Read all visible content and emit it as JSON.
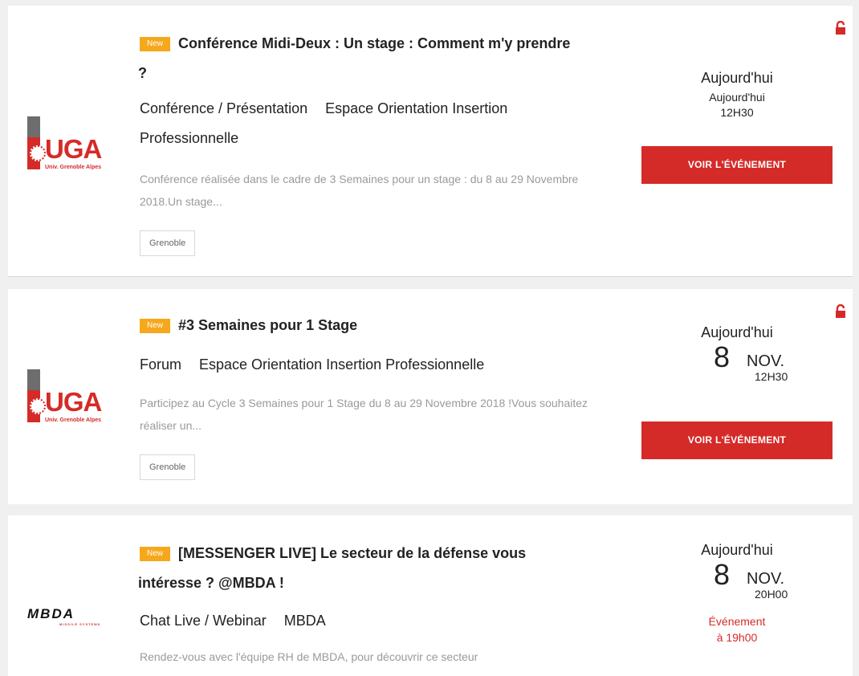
{
  "colors": {
    "accent": "#d52b28",
    "badge": "#f6a81c",
    "background": "#f0f0f0"
  },
  "events": [
    {
      "logo": {
        "text": "UGA",
        "sub": "Univ. Grenoble Alpes"
      },
      "badge": "New",
      "title": "Conférence Midi-Deux : Un stage : Comment m'y prendre ?",
      "type": "Conférence / Présentation",
      "organizer": "Espace Orientation Insertion Professionnelle",
      "description": "Conférence réalisée dans le cadre de 3 Semaines pour un stage : du 8 au 29 Novembre 2018.Un stage...",
      "location": "Grenoble",
      "date_label": "Aujourd'hui",
      "date_day": "Aujourd'hui",
      "time": "12H30",
      "button": "VOIR L'ÉVÉNEMENT",
      "lock_icon": "unlock-icon"
    },
    {
      "logo": {
        "text": "UGA",
        "sub": "Univ. Grenoble Alpes"
      },
      "badge": "New",
      "title": "#3 Semaines pour 1 Stage",
      "type": "Forum",
      "organizer": "Espace Orientation Insertion Professionnelle",
      "description": "Participez au Cycle 3 Semaines pour 1 Stage du 8 au 29 Novembre 2018 !Vous souhaitez réaliser un...",
      "location": "Grenoble",
      "date_label": "Aujourd'hui",
      "date_num": "8",
      "date_month": "NOV.",
      "time": "12H30",
      "button": "VOIR L'ÉVÉNEMENT",
      "lock_icon": "unlock-icon"
    },
    {
      "logo": {
        "text": "MBDA",
        "sub": "MISSILE SYSTEMS"
      },
      "badge": "New",
      "title": "[MESSENGER LIVE] Le secteur de la défense vous intéresse ? @MBDA !",
      "type": "Chat Live / Webinar",
      "organizer": "MBDA",
      "description": "Rendez-vous avec l'équipe RH de MBDA, pour découvrir ce secteur",
      "date_label": "Aujourd'hui",
      "date_num": "8",
      "date_month": "NOV.",
      "time": "20H00",
      "notice_line1": "Événement",
      "notice_line2": "à 19h00"
    }
  ]
}
